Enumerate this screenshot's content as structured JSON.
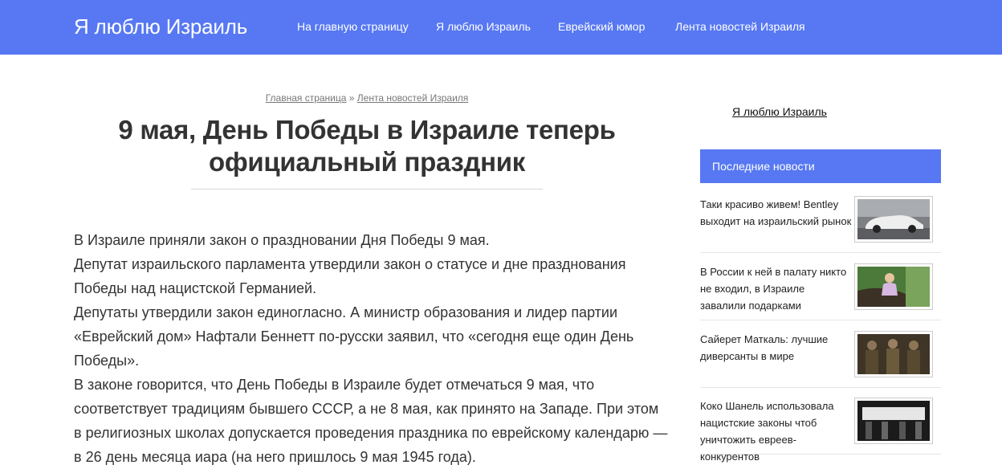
{
  "header": {
    "logo": "Я люблю Израиль",
    "nav": [
      {
        "label": "На главную страницу"
      },
      {
        "label": "Я люблю Израиль"
      },
      {
        "label": "Еврейский юмор"
      },
      {
        "label": "Лента новостей Израиля"
      }
    ],
    "bg_color": "#5778f2"
  },
  "breadcrumb": {
    "home": "Главная страница",
    "separator": "»",
    "category": "Лента новостей Израиля"
  },
  "article": {
    "title": "9 мая, День Победы в Израиле теперь официальный праздник",
    "paragraphs": [
      "В Израиле приняли закон о праздновании Дня Победы 9 мая.",
      "Депутат израильского парламента утвердили закон о статусе и дне празднования Победы над нацистской Германией.",
      "Депутаты утвердили закон единогласно. А министр образования и лидер партии «Еврейский дом» Нафтали Беннетт по-русски заявил, что «сегодня еще один День Победы».",
      "В законе говорится, что День Победы в Израиле будет отмечаться 9 мая, что соответствует традициям бывшего СССР, а не 8 мая, как принято на Западе. При этом в религиозных школах допускается проведения праздника по еврейскому календарю — в 26 день месяца иара (на него пришлось 9 мая 1945 года)."
    ]
  },
  "sidebar": {
    "link": "Я люблю Израиль",
    "latest_header": "Последние новости",
    "news": [
      {
        "title": "Таки красиво живем! Bentley выходит на израильский рынок",
        "thumb": "car-photo"
      },
      {
        "title": "В России к ней в палату никто не входил, в Израиле завалили подарками",
        "thumb": "person-photo"
      },
      {
        "title": "Сайерет Маткаль: лучшие диверсанты в мире",
        "thumb": "soldiers-photo"
      },
      {
        "title": "Коко Шанель использовала нацистские законы чтоб уничтожить евреев-конкурентов",
        "thumb": "street-photo"
      }
    ]
  }
}
